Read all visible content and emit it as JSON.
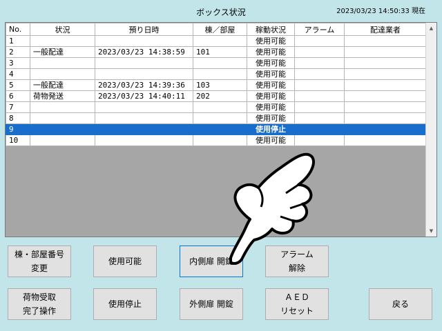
{
  "header": {
    "title": "ボックス状況",
    "datetime": "2023/03/23 14:50:33 現在"
  },
  "table": {
    "columns": [
      "No.",
      "状況",
      "預り日時",
      "棟／部屋",
      "稼動状況",
      "アラーム",
      "配達業者"
    ],
    "rows": [
      {
        "no": "1",
        "situation": "",
        "deposit_time": "",
        "room": "",
        "status": "使用可能",
        "alarm": "",
        "courier": ""
      },
      {
        "no": "2",
        "situation": "一般配達",
        "deposit_time": "2023/03/23 14:38:59",
        "room": "101",
        "status": "使用可能",
        "alarm": "",
        "courier": ""
      },
      {
        "no": "3",
        "situation": "",
        "deposit_time": "",
        "room": "",
        "status": "使用可能",
        "alarm": "",
        "courier": ""
      },
      {
        "no": "4",
        "situation": "",
        "deposit_time": "",
        "room": "",
        "status": "使用可能",
        "alarm": "",
        "courier": ""
      },
      {
        "no": "5",
        "situation": "一般配達",
        "deposit_time": "2023/03/23 14:39:36",
        "room": "103",
        "status": "使用可能",
        "alarm": "",
        "courier": ""
      },
      {
        "no": "6",
        "situation": "荷物発送",
        "deposit_time": "2023/03/23 14:40:11",
        "room": "202",
        "status": "使用可能",
        "alarm": "",
        "courier": ""
      },
      {
        "no": "7",
        "situation": "",
        "deposit_time": "",
        "room": "",
        "status": "使用可能",
        "alarm": "",
        "courier": ""
      },
      {
        "no": "8",
        "situation": "",
        "deposit_time": "",
        "room": "",
        "status": "使用可能",
        "alarm": "",
        "courier": ""
      },
      {
        "no": "9",
        "situation": "",
        "deposit_time": "",
        "room": "",
        "status": "使用停止",
        "alarm": "",
        "courier": ""
      },
      {
        "no": "10",
        "situation": "",
        "deposit_time": "",
        "room": "",
        "status": "使用可能",
        "alarm": "",
        "courier": ""
      }
    ],
    "selected_row": "9"
  },
  "buttons": {
    "room_number_change": "棟・部屋番号\n変更",
    "enable_use": "使用可能",
    "inner_door_open": "内側扉 開錠",
    "alarm_release": "アラーム\n解除",
    "receipt_complete": "荷物受取\n完了操作",
    "disable_use": "使用停止",
    "outer_door_open": "外側扉 開錠",
    "aed_reset": "ＡＥＤ\nリセット",
    "back": "戻る"
  },
  "icons": {
    "scroll_up": "scroll-up-arrow",
    "scroll_down": "scroll-down-arrow",
    "pointer": "pointing-hand"
  },
  "colors": {
    "background": "#c1e5e8",
    "selection": "#1a6ecb"
  }
}
